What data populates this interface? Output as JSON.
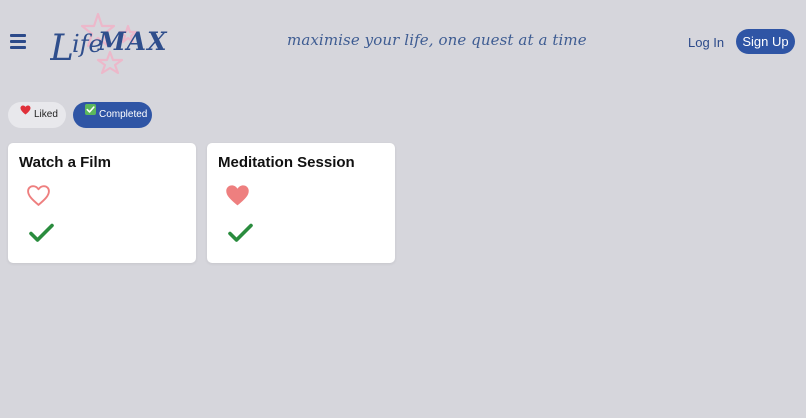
{
  "header": {
    "logo_text": "LifeMAX",
    "tagline": "maximise your life, one quest at a time",
    "login_label": "Log In",
    "signup_label": "Sign Up"
  },
  "filters": [
    {
      "label": "Liked",
      "icon": "red-heart-icon",
      "selected": false
    },
    {
      "label": "Completed",
      "icon": "checkmark-box-icon",
      "selected": true
    }
  ],
  "cards": [
    {
      "title": "Watch a Film",
      "liked": false,
      "completed": true
    },
    {
      "title": "Meditation Session",
      "liked": true,
      "completed": true
    }
  ],
  "colors": {
    "background": "#d6d6dc",
    "primary": "#2f55a5",
    "heart": "#ee7f7f",
    "check": "#2a8c3e"
  }
}
